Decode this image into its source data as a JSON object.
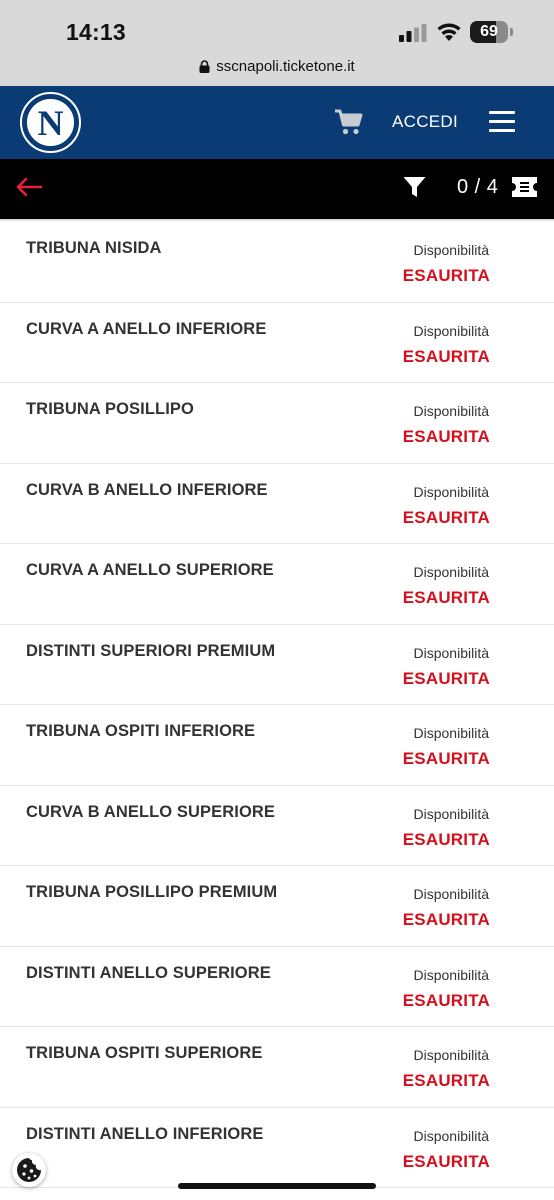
{
  "status_bar": {
    "time": "14:13",
    "battery": "69",
    "battery_level": 0.69
  },
  "browser": {
    "url": "sscnapoli.ticketone.it"
  },
  "header": {
    "logo_letter": "N",
    "login_label": "ACCEDI",
    "icons": [
      "cart-icon",
      "hamburger-menu-icon"
    ],
    "brand_color": "#0b3b75"
  },
  "toolbar": {
    "counter": "0 / 4",
    "icons": [
      "back-arrow-icon",
      "filter-icon",
      "ticket-icon"
    ],
    "back_color": "#e8203a"
  },
  "sectors": [
    {
      "name": "TRIBUNA NISIDA",
      "availability_label": "Disponibilità",
      "status": "ESAURITA"
    },
    {
      "name": "CURVA A ANELLO INFERIORE",
      "availability_label": "Disponibilità",
      "status": "ESAURITA"
    },
    {
      "name": "TRIBUNA POSILLIPO",
      "availability_label": "Disponibilità",
      "status": "ESAURITA"
    },
    {
      "name": "CURVA B ANELLO INFERIORE",
      "availability_label": "Disponibilità",
      "status": "ESAURITA"
    },
    {
      "name": "CURVA A ANELLO SUPERIORE",
      "availability_label": "Disponibilità",
      "status": "ESAURITA"
    },
    {
      "name": "DISTINTI SUPERIORI PREMIUM",
      "availability_label": "Disponibilità",
      "status": "ESAURITA"
    },
    {
      "name": "TRIBUNA OSPITI INFERIORE",
      "availability_label": "Disponibilità",
      "status": "ESAURITA"
    },
    {
      "name": "CURVA B ANELLO SUPERIORE",
      "availability_label": "Disponibilità",
      "status": "ESAURITA"
    },
    {
      "name": "TRIBUNA POSILLIPO PREMIUM",
      "availability_label": "Disponibilità",
      "status": "ESAURITA"
    },
    {
      "name": "DISTINTI ANELLO SUPERIORE",
      "availability_label": "Disponibilità",
      "status": "ESAURITA"
    },
    {
      "name": "TRIBUNA OSPITI SUPERIORE",
      "availability_label": "Disponibilità",
      "status": "ESAURITA"
    },
    {
      "name": "DISTINTI ANELLO INFERIORE",
      "availability_label": "Disponibilità",
      "status": "ESAURITA"
    }
  ],
  "colors": {
    "sold_out": "#d50f1c",
    "toolbar_bg": "#000000"
  },
  "overlays": {
    "cookie_icon": "cookie-icon"
  }
}
